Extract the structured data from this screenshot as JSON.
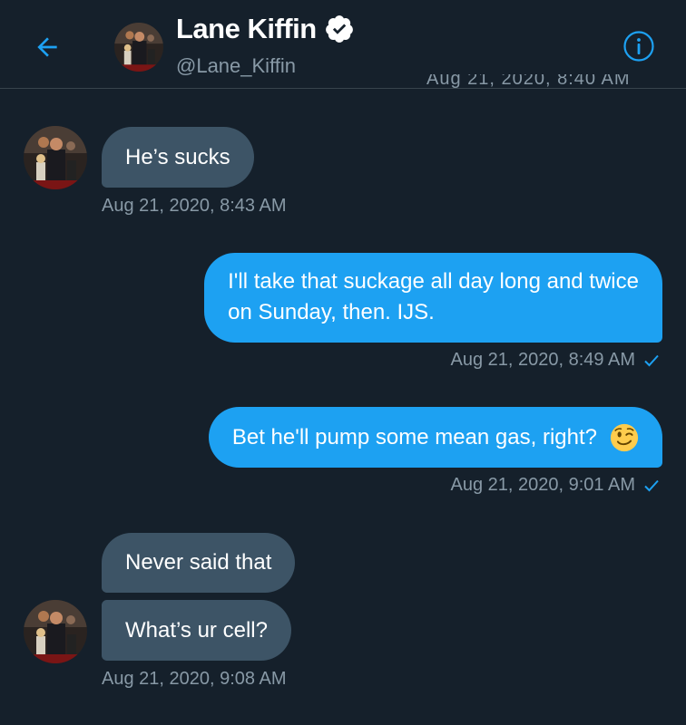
{
  "header": {
    "name": "Lane Kiffin",
    "handle": "@Lane_Kiffin",
    "clipped_timestamp": "Aug 21, 2020, 8:40 AM"
  },
  "colors": {
    "background": "#15202b",
    "incoming_bubble": "#3d5466",
    "outgoing_bubble": "#1da1f2",
    "accent": "#1da1f2",
    "muted_text": "#8899a6"
  },
  "messages": [
    {
      "direction": "in",
      "text": "He’s sucks",
      "timestamp": "Aug 21, 2020, 8:43 AM"
    },
    {
      "direction": "out",
      "text_line1": "I'll take that suckage all day long and twice",
      "text_line2": "on Sunday, then. IJS.",
      "timestamp": "Aug 21, 2020, 8:49 AM"
    },
    {
      "direction": "out",
      "text": "Bet he'll pump some mean gas, right?",
      "emoji": "winking-face",
      "timestamp": "Aug 21, 2020, 9:01 AM"
    },
    {
      "direction": "in",
      "text": "Never said that"
    },
    {
      "direction": "in",
      "text": "What’s ur cell?",
      "timestamp": "Aug 21, 2020, 9:08 AM"
    }
  ]
}
